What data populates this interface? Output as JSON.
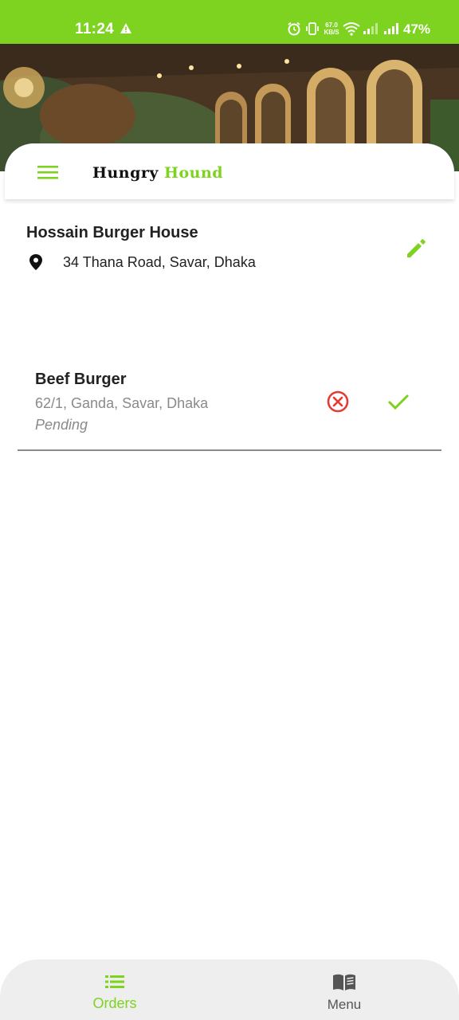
{
  "status_bar": {
    "time": "11:24",
    "net_speed_value": "67.0",
    "net_speed_unit": "KB/S",
    "battery": "47%",
    "icons": [
      "warning-icon",
      "alarm-icon",
      "vibrate-icon",
      "wifi-icon",
      "signal-icon",
      "signal-icon"
    ]
  },
  "app_bar": {
    "brand_part1": "Hungry",
    "brand_part2": "Hound",
    "menu_icon": "hamburger-icon"
  },
  "restaurant": {
    "name": "Hossain Burger House",
    "address": "34 Thana Road, Savar, Dhaka",
    "address_icon": "location-pin-icon",
    "edit_icon": "pencil-icon"
  },
  "orders": [
    {
      "title": "Beef Burger",
      "address": "62/1, Ganda, Savar, Dhaka",
      "status": "Pending",
      "reject_icon": "cancel-circle-icon",
      "accept_icon": "checkmark-icon"
    }
  ],
  "bottom_nav": {
    "items": [
      {
        "label": "Orders",
        "icon": "list-icon",
        "active": true
      },
      {
        "label": "Menu",
        "icon": "book-icon",
        "active": false
      }
    ]
  },
  "colors": {
    "accent": "#7ed321",
    "danger": "#e53935",
    "muted_text": "#8a8a8a",
    "nav_background": "#eeeeee"
  }
}
